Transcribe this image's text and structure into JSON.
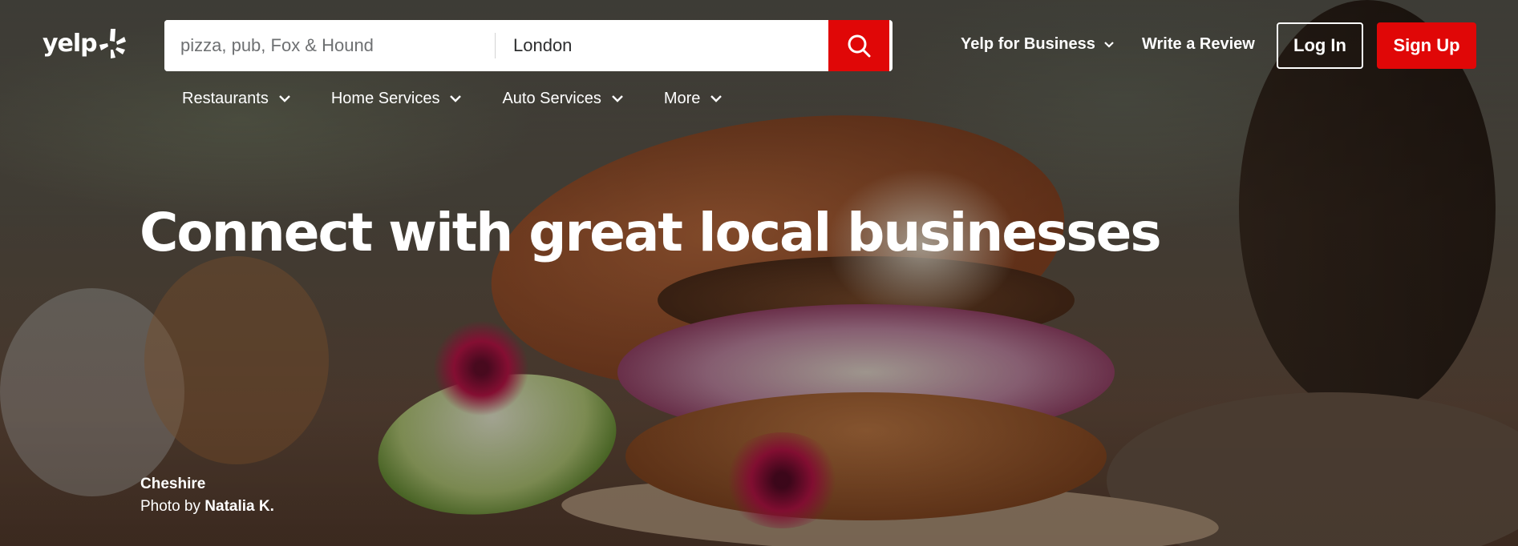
{
  "brand": {
    "logo_text": "yelp",
    "accent": "#e00707"
  },
  "search": {
    "find_placeholder": "pizza, pub, Fox & Hound",
    "near_value": "London",
    "button_icon": "search-icon"
  },
  "header": {
    "business_label": "Yelp for Business",
    "review_label": "Write a Review",
    "login_label": "Log In",
    "signup_label": "Sign Up"
  },
  "categories": [
    {
      "label": "Restaurants"
    },
    {
      "label": "Home Services"
    },
    {
      "label": "Auto Services"
    },
    {
      "label": "More"
    }
  ],
  "hero": {
    "headline": "Connect with great local businesses",
    "location": "Cheshire",
    "photo_by_prefix": "Photo by",
    "photographer": "Natalia K."
  }
}
